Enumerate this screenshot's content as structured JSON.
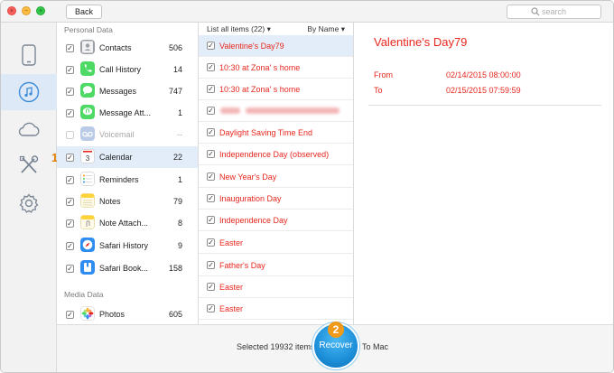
{
  "titlebar": {
    "back_label": "Back",
    "search_placeholder": "search"
  },
  "categories": {
    "personal_label": "Personal Data",
    "media_label": "Media Data",
    "items": [
      {
        "label": "Contacts",
        "count": "506",
        "icon": "contacts-icon",
        "color": "#8b8f96"
      },
      {
        "label": "Call History",
        "count": "14",
        "icon": "phone-icon",
        "color": "#4cd964"
      },
      {
        "label": "Messages",
        "count": "747",
        "icon": "messages-icon",
        "color": "#4cd964"
      },
      {
        "label": "Message Att...",
        "count": "1",
        "icon": "message-attachment-icon",
        "color": "#4cd964"
      },
      {
        "label": "Voicemail",
        "count": "--",
        "icon": "voicemail-icon",
        "color": "#b7c9e6"
      },
      {
        "label": "Calendar",
        "count": "22",
        "icon": "calendar-icon",
        "color": "#ffffff"
      },
      {
        "label": "Reminders",
        "count": "1",
        "icon": "reminders-icon",
        "color": "#ffffff"
      },
      {
        "label": "Notes",
        "count": "79",
        "icon": "notes-icon",
        "color": "#ffd33a"
      },
      {
        "label": "Note Attach...",
        "count": "8",
        "icon": "note-attachment-icon",
        "color": "#ffd33a"
      },
      {
        "label": "Safari History",
        "count": "9",
        "icon": "safari-icon",
        "color": "#2f8cf0"
      },
      {
        "label": "Safari Book...",
        "count": "158",
        "icon": "safari-bookmark-icon",
        "color": "#2f8cf0"
      }
    ],
    "media_items": [
      {
        "label": "Photos",
        "count": "605",
        "icon": "photos-icon"
      }
    ],
    "step_badge": "1"
  },
  "list": {
    "header_left": "List all items (22)",
    "header_right": "By Name",
    "items": [
      "Valentine's Day79",
      "10:30 at Zona' s home",
      "10:30 at Zona' s home",
      "",
      "Daylight Saving Time End",
      "Independence Day (observed)",
      "New Year's Day",
      "Inauguration Day",
      "Independence Day",
      "Easter",
      "Father's Day",
      "Easter",
      "Easter"
    ]
  },
  "detail": {
    "title": "Valentine's Day79",
    "from_label": "From",
    "from_value": "02/14/2015 08:00:00",
    "to_label": "To",
    "to_value": "02/15/2015 07:59:59"
  },
  "footer": {
    "selected_text": "Selected 19932 items",
    "recover_label": "Recover",
    "to_mac": "To Mac",
    "step_badge": "2"
  },
  "colors": {
    "accent_red": "#e8271e",
    "selection": "#e3edf9",
    "recover_blue": "#1d8fd8",
    "step_orange": "#f19a1a"
  }
}
